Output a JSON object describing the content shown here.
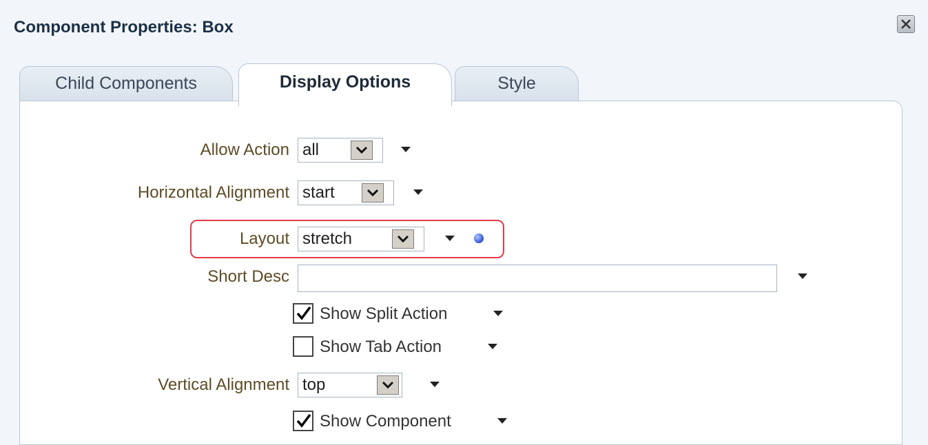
{
  "dialog": {
    "title": "Component Properties: Box"
  },
  "tabs": [
    {
      "label": "Child Components",
      "active": false
    },
    {
      "label": "Display Options",
      "active": true
    },
    {
      "label": "Style",
      "active": false
    }
  ],
  "fields": {
    "allow_action": {
      "label": "Allow Action",
      "value": "all"
    },
    "horizontal_alignment": {
      "label": "Horizontal Alignment",
      "value": "start"
    },
    "layout": {
      "label": "Layout",
      "value": "stretch"
    },
    "short_desc": {
      "label": "Short Desc",
      "value": ""
    },
    "show_split_action": {
      "label": "Show Split Action",
      "checked": true
    },
    "show_tab_action": {
      "label": "Show Tab Action",
      "checked": false
    },
    "vertical_alignment": {
      "label": "Vertical Alignment",
      "value": "top"
    },
    "show_component": {
      "label": "Show Component",
      "checked": true
    }
  },
  "icons": {
    "close": "close-icon",
    "dropdown": "chevron-down-icon",
    "menu": "menu-arrow-icon",
    "status": "blue-dot-icon",
    "check": "check-icon"
  },
  "colors": {
    "title": "#1c3047",
    "label": "#5d4b25",
    "highlight": "#e23b46",
    "status_dot": "#2c4fd6"
  }
}
